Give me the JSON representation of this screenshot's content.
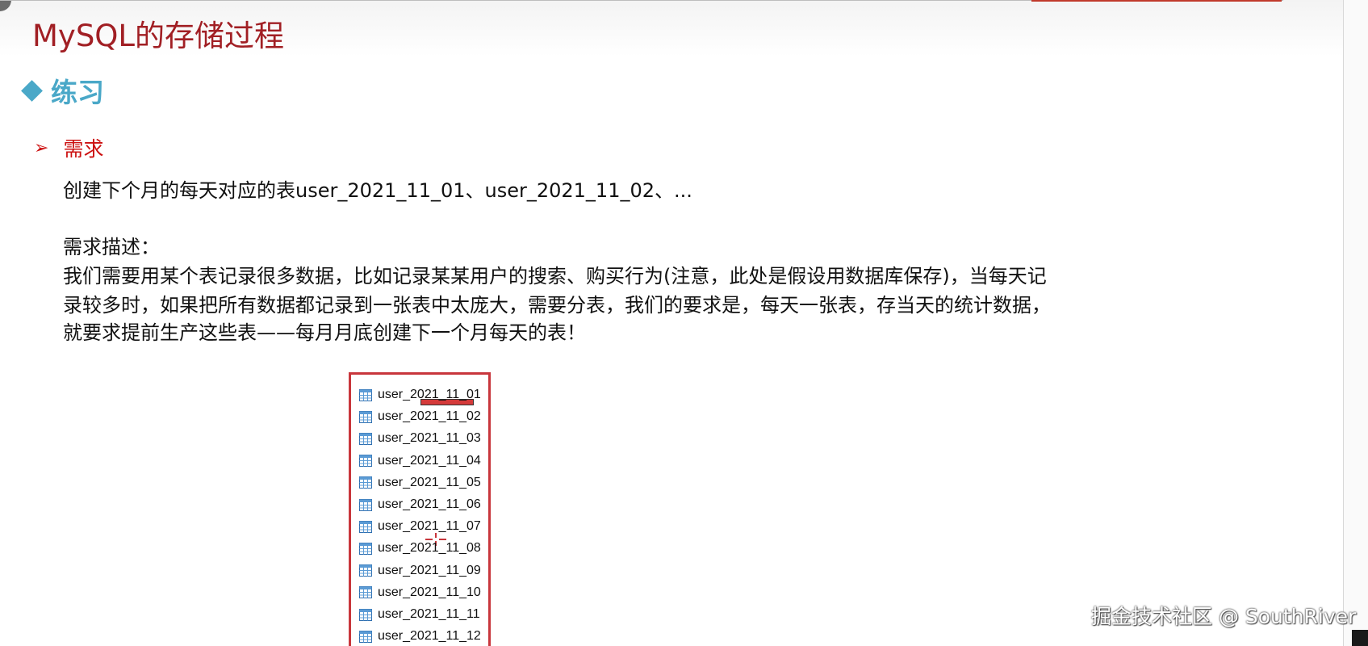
{
  "slide": {
    "title": "MySQL的存储过程",
    "section": "练习",
    "requirement_label": "需求",
    "requirement_text": "创建下个月的每天对应的表user_2021_11_01、user_2021_11_02、...",
    "description_heading": "需求描述：",
    "description_lines": [
      "我们需要用某个表记录很多数据，比如记录某某用户的搜索、购买行为(注意，此处是假设用数据库保存)，当每天记",
      "录较多时，如果把所有数据都记录到一张表中太庞大，需要分表，我们的要求是，每天一张表，存当天的统计数据，",
      "就要求提前生产这些表——每月月底创建下一个月每天的表！"
    ],
    "tables": [
      "user_2021_11_01",
      "user_2021_11_02",
      "user_2021_11_03",
      "user_2021_11_04",
      "user_2021_11_05",
      "user_2021_11_06",
      "user_2021_11_07",
      "user_2021_11_08",
      "user_2021_11_09",
      "user_2021_11_10",
      "user_2021_11_11",
      "user_2021_11_12"
    ]
  },
  "watermark": "掘金技术社区 @ SouthRiver",
  "colors": {
    "title": "#a11f24",
    "section": "#4aa8c8",
    "requirement": "#cc1111",
    "table_box_border": "#c8363c"
  },
  "icons": {
    "section_bullet": "diamond-icon",
    "requirement_bullet": "arrow-right-icon",
    "table_item": "table-icon"
  }
}
